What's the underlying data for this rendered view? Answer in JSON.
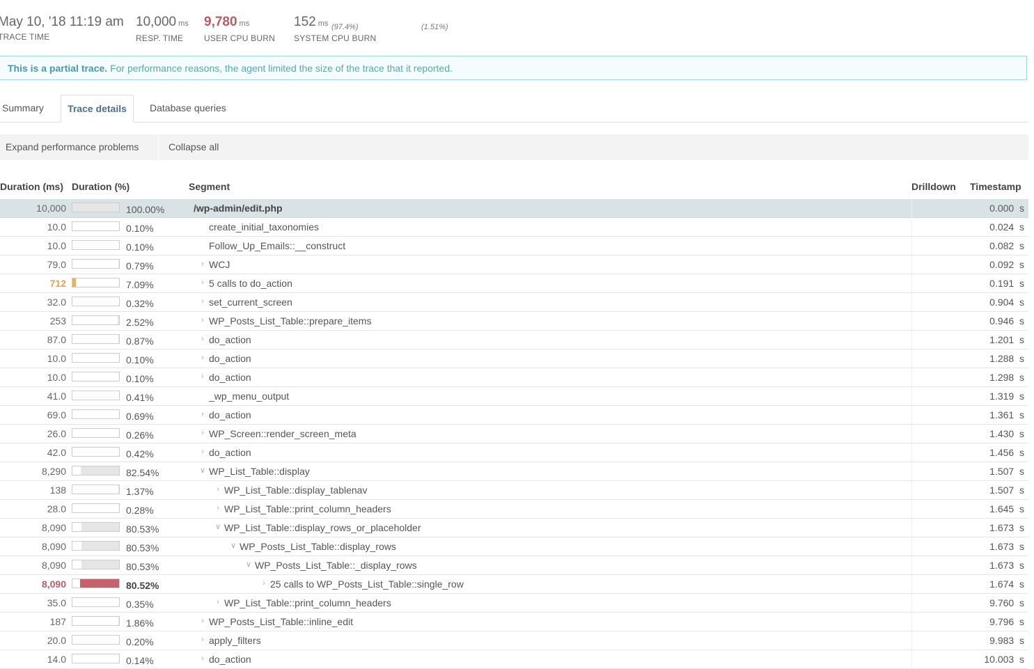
{
  "metrics": [
    {
      "value": "May 10, '18 11:19 am",
      "unit": "",
      "pct": "",
      "label": "TRACE TIME"
    },
    {
      "value": "10,000",
      "unit": "ms",
      "pct": "",
      "label": "RESP. TIME"
    },
    {
      "value": "9,780",
      "unit": "ms",
      "pct": "(97.4%)",
      "label": "USER CPU BURN"
    },
    {
      "value": "152",
      "unit": "ms",
      "pct": "(1.51%)",
      "label": "SYSTEM CPU BURN"
    }
  ],
  "notice": {
    "strong": "This is a partial trace.",
    "text": "For performance reasons, the agent limited the size of the trace that it reported."
  },
  "tabs": {
    "summary": "Summary",
    "trace_details": "Trace details",
    "database_queries": "Database queries"
  },
  "toolbar": {
    "expand": "Expand performance problems",
    "collapse": "Collapse all"
  },
  "table": {
    "headers": {
      "duration_ms": "Duration (ms)",
      "duration_pct": "Duration (%)",
      "segment": "Segment",
      "drilldown": "Drilldown",
      "timestamp": "Timestamp"
    },
    "rows": [
      {
        "dur": "10,000",
        "fraction": 1.0,
        "pct": "100.00%",
        "seg": "/wp-admin/edit.php",
        "ts": "0.000  s",
        "depth": 0,
        "caret": "",
        "state": "root"
      },
      {
        "dur": "10.0",
        "fraction": 0.001,
        "pct": "0.10%",
        "seg": "create_initial_taxonomies",
        "ts": "0.024  s",
        "depth": 1,
        "caret": "",
        "state": ""
      },
      {
        "dur": "10.0",
        "fraction": 0.001,
        "pct": "0.10%",
        "seg": "Follow_Up_Emails::__construct",
        "ts": "0.082  s",
        "depth": 1,
        "caret": "",
        "state": ""
      },
      {
        "dur": "79.0",
        "fraction": 0.0079,
        "pct": "0.79%",
        "seg": "WCJ",
        "ts": "0.092  s",
        "depth": 1,
        "caret": "right",
        "state": ""
      },
      {
        "dur": "712",
        "fraction": 0.0709,
        "pct": "7.09%",
        "seg": "5 calls to do_action",
        "ts": "0.191  s",
        "depth": 1,
        "caret": "right",
        "state": "warn"
      },
      {
        "dur": "32.0",
        "fraction": 0.0032,
        "pct": "0.32%",
        "seg": "set_current_screen",
        "ts": "0.904  s",
        "depth": 1,
        "caret": "right",
        "state": ""
      },
      {
        "dur": "253",
        "fraction": 0.0252,
        "pct": "2.52%",
        "seg": "WP_Posts_List_Table::prepare_items",
        "ts": "0.946  s",
        "depth": 1,
        "caret": "right",
        "state": ""
      },
      {
        "dur": "87.0",
        "fraction": 0.0087,
        "pct": "0.87%",
        "seg": "do_action",
        "ts": "1.201  s",
        "depth": 1,
        "caret": "right",
        "state": ""
      },
      {
        "dur": "10.0",
        "fraction": 0.001,
        "pct": "0.10%",
        "seg": "do_action",
        "ts": "1.288  s",
        "depth": 1,
        "caret": "right",
        "state": ""
      },
      {
        "dur": "10.0",
        "fraction": 0.001,
        "pct": "0.10%",
        "seg": "do_action",
        "ts": "1.298  s",
        "depth": 1,
        "caret": "right",
        "state": ""
      },
      {
        "dur": "41.0",
        "fraction": 0.0041,
        "pct": "0.41%",
        "seg": "_wp_menu_output",
        "ts": "1.319  s",
        "depth": 1,
        "caret": "",
        "state": ""
      },
      {
        "dur": "69.0",
        "fraction": 0.0069,
        "pct": "0.69%",
        "seg": "do_action",
        "ts": "1.361  s",
        "depth": 1,
        "caret": "right",
        "state": ""
      },
      {
        "dur": "26.0",
        "fraction": 0.0026,
        "pct": "0.26%",
        "seg": "WP_Screen::render_screen_meta",
        "ts": "1.430  s",
        "depth": 1,
        "caret": "right",
        "state": ""
      },
      {
        "dur": "42.0",
        "fraction": 0.0042,
        "pct": "0.42%",
        "seg": "do_action",
        "ts": "1.456  s",
        "depth": 1,
        "caret": "right",
        "state": ""
      },
      {
        "dur": "8,290",
        "fraction": 0.8254,
        "pct": "82.54%",
        "seg": "WP_List_Table::display",
        "ts": "1.507  s",
        "depth": 1,
        "caret": "down",
        "state": ""
      },
      {
        "dur": "138",
        "fraction": 0.0137,
        "pct": "1.37%",
        "seg": "WP_List_Table::display_tablenav",
        "ts": "1.507  s",
        "depth": 2,
        "caret": "right",
        "state": ""
      },
      {
        "dur": "28.0",
        "fraction": 0.0028,
        "pct": "0.28%",
        "seg": "WP_List_Table::print_column_headers",
        "ts": "1.645  s",
        "depth": 2,
        "caret": "right",
        "state": ""
      },
      {
        "dur": "8,090",
        "fraction": 0.8053,
        "pct": "80.53%",
        "seg": "WP_List_Table::display_rows_or_placeholder",
        "ts": "1.673  s",
        "depth": 2,
        "caret": "down",
        "state": ""
      },
      {
        "dur": "8,090",
        "fraction": 0.8053,
        "pct": "80.53%",
        "seg": "WP_Posts_List_Table::display_rows",
        "ts": "1.673  s",
        "depth": 3,
        "caret": "down",
        "state": ""
      },
      {
        "dur": "8,090",
        "fraction": 0.8053,
        "pct": "80.53%",
        "seg": "WP_Posts_List_Table::_display_rows",
        "ts": "1.673  s",
        "depth": 4,
        "caret": "down",
        "state": ""
      },
      {
        "dur": "8,090",
        "fraction": 0.8052,
        "pct": "80.52%",
        "seg": "25 calls to WP_Posts_List_Table::single_row",
        "ts": "1.674  s",
        "depth": 5,
        "caret": "right",
        "state": "hot"
      },
      {
        "dur": "35.0",
        "fraction": 0.0035,
        "pct": "0.35%",
        "seg": "WP_List_Table::print_column_headers",
        "ts": "9.760  s",
        "depth": 2,
        "caret": "right",
        "state": ""
      },
      {
        "dur": "187",
        "fraction": 0.0186,
        "pct": "1.86%",
        "seg": "WP_Posts_List_Table::inline_edit",
        "ts": "9.796  s",
        "depth": 1,
        "caret": "right",
        "state": ""
      },
      {
        "dur": "20.0",
        "fraction": 0.002,
        "pct": "0.20%",
        "seg": "apply_filters",
        "ts": "9.983  s",
        "depth": 1,
        "caret": "right",
        "state": ""
      },
      {
        "dur": "14.0",
        "fraction": 0.0014,
        "pct": "0.14%",
        "seg": "do_action",
        "ts": "10.003  s",
        "depth": 1,
        "caret": "right",
        "state": ""
      }
    ]
  }
}
